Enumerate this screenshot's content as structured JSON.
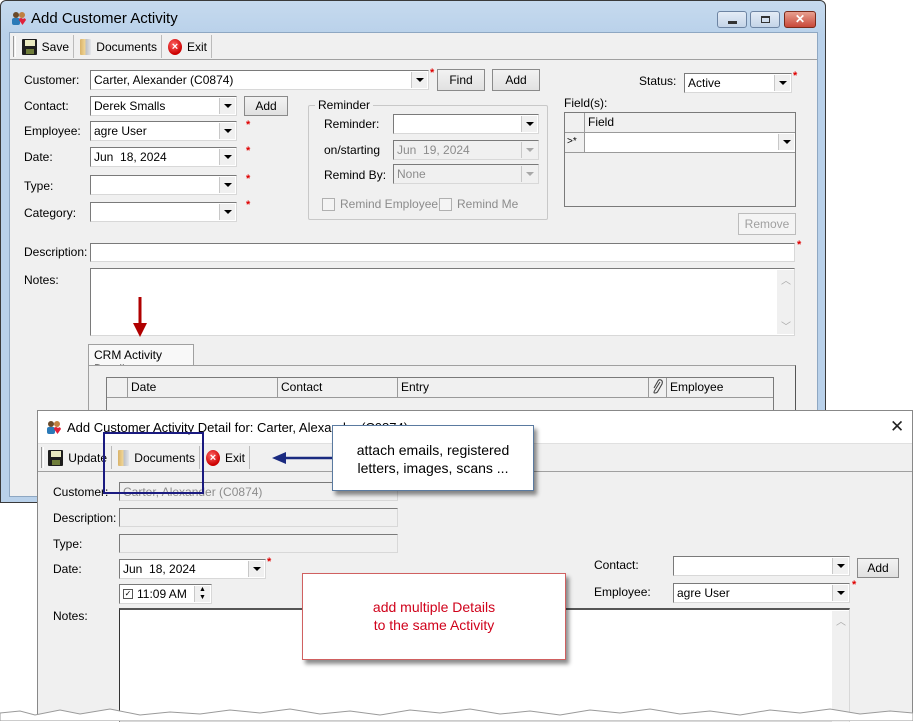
{
  "main_window": {
    "title": "Add Customer Activity",
    "window_controls": [
      "minimize",
      "maximize",
      "close"
    ],
    "toolbar": [
      {
        "label": "Save",
        "icon": "save-icon"
      },
      {
        "label": "Documents",
        "icon": "documents-icon"
      },
      {
        "label": "Exit",
        "icon": "exit-icon"
      }
    ],
    "form": {
      "customer_label": "Customer:",
      "customer_value": "Carter, Alexander (C0874)",
      "find_label": "Find",
      "add_label": "Add",
      "status_label": "Status:",
      "status_value": "Active",
      "contact_label": "Contact:",
      "contact_value": "Derek Smalls",
      "contact_add_label": "Add",
      "employee_label": "Employee:",
      "employee_value": "agre User",
      "date_label": "Date:",
      "date_value": "Jun  18, 2024",
      "type_label": "Type:",
      "type_value": "",
      "category_label": "Category:",
      "category_value": "",
      "description_label": "Description:",
      "description_value": "",
      "notes_label": "Notes:",
      "notes_value": ""
    },
    "reminder": {
      "group_title": "Reminder",
      "reminder_label": "Reminder:",
      "reminder_value": "",
      "on_starting_label": "on/starting",
      "on_starting_value": "Jun  19, 2024",
      "remind_by_label": "Remind By:",
      "remind_by_value": "None",
      "remind_employee_label": "Remind Employee",
      "remind_me_label": "Remind Me"
    },
    "fields": {
      "label": "Field(s):",
      "column": "Field",
      "row_marker": ">*",
      "remove_label": "Remove"
    },
    "tabs": [
      {
        "label": "CRM Activity Detail"
      }
    ],
    "detail_grid": {
      "columns": [
        "Date",
        "Contact",
        "Entry",
        "Employee"
      ]
    }
  },
  "detail_window": {
    "title": "Add Customer Activity Detail for: Carter, Alexander (C0874)",
    "toolbar": [
      {
        "label": "Update",
        "icon": "save-icon"
      },
      {
        "label": "Documents",
        "icon": "documents-icon"
      },
      {
        "label": "Exit",
        "icon": "exit-icon"
      }
    ],
    "form": {
      "customer_label": "Customer:",
      "customer_value": "Carter, Alexander (C0874)",
      "description_label": "Description:",
      "description_value": "",
      "type_label": "Type:",
      "type_value": "",
      "date_label": "Date:",
      "date_value": "Jun  18, 2024",
      "time_value": "11:09 AM",
      "time_checked": true,
      "notes_label": "Notes:",
      "notes_value": "",
      "contact_label": "Contact:",
      "contact_value": "",
      "contact_add_label": "Add",
      "employee_label": "Employee:",
      "employee_value": "agre User"
    }
  },
  "annotations": {
    "documents_callout": "attach emails, registered letters, images, scans ...",
    "details_callout_line1": "add multiple Details",
    "details_callout_line2": "to the same Activity",
    "colors": {
      "highlight_box": "#1a1a80",
      "arrow_blue": "#1a2a80",
      "arrow_red": "#b00000",
      "details_callout_text": "#d0021b",
      "details_callout_border": "#d06060"
    }
  }
}
